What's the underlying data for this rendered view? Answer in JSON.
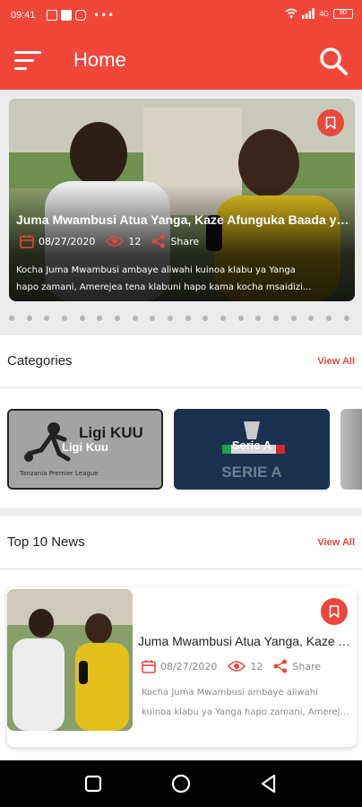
{
  "status_bar": {
    "time": "09:41",
    "notification_icons": [
      "email-icon",
      "facebook-icon",
      "instagram-icon"
    ],
    "more_dots": "•••",
    "right_text": "4G",
    "battery_level": "80"
  },
  "app_bar": {
    "title": "Home",
    "menu_icon": "menu-icon",
    "search_icon": "search-icon",
    "color": "#f1473a"
  },
  "featured": {
    "headline": "Juma Mwambusi Atua Yanga, Kaze Afunguka Baada ya...",
    "date": "08/27/2020",
    "views": "12",
    "share_label": "Share",
    "description_line1": "Kocha Juma Mwambusi ambaye aliwahi kuinoa klabu ya Yanga",
    "description_line2": "hapo zamani, Amerejea tena klabuni hapo kama kocha msaidizi..."
  },
  "pager": {
    "count": 20,
    "active_index": 0
  },
  "categories": {
    "title": "Categories",
    "view_all": "View All",
    "items": [
      {
        "label": "Ligi Kuu",
        "logo_text": "Ligi KUU",
        "logo_sub": "Tanzania Premier League"
      },
      {
        "label": "Serie A",
        "logo_text": "SERIE A"
      }
    ]
  },
  "top_news": {
    "title": "Top 10 News",
    "view_all": "View All",
    "items": [
      {
        "headline": "Juma Mwambusi Atua Yanga, Kaze Afunguka Baada ya...",
        "date": "08/27/2020",
        "views": "12",
        "share_label": "Share",
        "description_line1": "Kocha Juma Mwambusi ambaye aliwahi",
        "description_line2": "kuinoa klabu ya Yanga hapo zamani, Amerejea tena..."
      }
    ]
  },
  "colors": {
    "accent": "#e8473a",
    "serie_a_bg": "#1b3150",
    "ligi_kuu_bg": "#9a9a9a"
  }
}
